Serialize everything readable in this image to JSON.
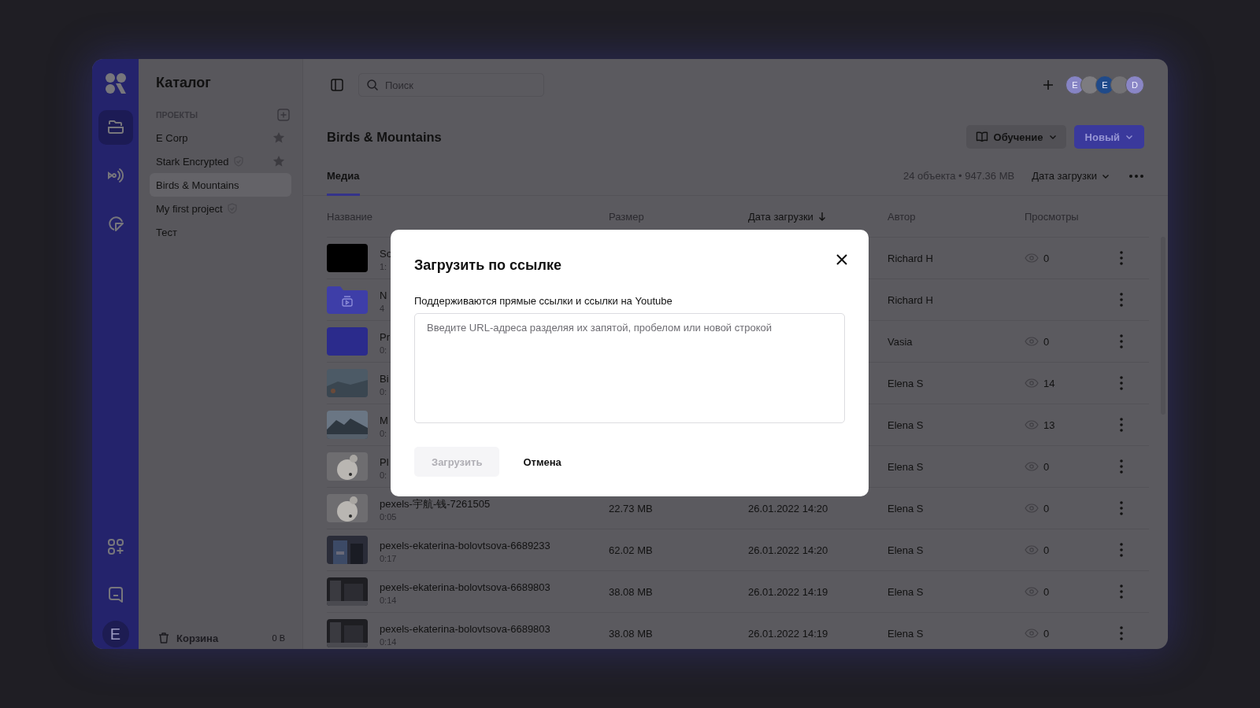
{
  "rail": {
    "items": [
      {
        "kind": "folder",
        "selected": true
      },
      {
        "kind": "broadcast",
        "selected": false
      },
      {
        "kind": "chart",
        "selected": false
      }
    ],
    "bottom": [
      {
        "kind": "apps"
      },
      {
        "kind": "chat"
      }
    ],
    "avatar": {
      "letter": "E"
    }
  },
  "sidebar": {
    "title": "Каталог",
    "section": "ПРОЕКТЫ",
    "items": [
      {
        "label": "E Corp",
        "verified": false,
        "starred": true,
        "selected": false
      },
      {
        "label": "Stark Encrypted",
        "verified": true,
        "starred": true,
        "selected": false
      },
      {
        "label": "Birds & Mountains",
        "verified": false,
        "starred": false,
        "selected": true
      },
      {
        "label": "My first project",
        "verified": true,
        "starred": false,
        "selected": false
      },
      {
        "label": "Тест",
        "verified": false,
        "starred": false,
        "selected": false
      }
    ],
    "trash": {
      "label": "Корзина",
      "size": "0 B"
    }
  },
  "topbar": {
    "search": {
      "placeholder": "Поиск"
    },
    "avatars": [
      {
        "letter": "E",
        "color": "#8684c4"
      },
      {
        "color": "#7d7c80"
      },
      {
        "letter": "E",
        "color": "#1f4a8a"
      },
      {
        "color": "#737275"
      },
      {
        "letter": "D",
        "color": "#8a86c6"
      }
    ]
  },
  "header": {
    "title": "Birds & Mountains",
    "buttons": [
      {
        "label": "Обучение",
        "kind": "secondary"
      },
      {
        "label": "Новый",
        "kind": "primary"
      }
    ]
  },
  "tabs": [
    {
      "label": "Медиа",
      "selected": true
    }
  ],
  "summary": "24 объекта • 947.36 MB",
  "sort": "Дата загрузки",
  "table": {
    "columns": [
      {
        "label": "Название",
        "sorted": false
      },
      {
        "label": "Размер",
        "sorted": false
      },
      {
        "label": "Дата загрузки",
        "sorted": true
      },
      {
        "label": "Автор",
        "sorted": false
      },
      {
        "label": "Просмотры",
        "sorted": false
      }
    ],
    "rows": [
      {
        "thumb": {
          "kind": "solid",
          "color": "#000000"
        },
        "name": "So",
        "duration": "1:",
        "author": "Richard H",
        "views": "0"
      },
      {
        "thumb": {
          "kind": "folder"
        },
        "name": "N",
        "duration": "4",
        "author": "Richard H"
      },
      {
        "thumb": {
          "kind": "solid",
          "color": "#2b2b8c"
        },
        "name": "Pr",
        "duration": "0:",
        "author": "Vasia",
        "views": "0"
      },
      {
        "name": "Bi",
        "duration": "0:",
        "author": "Elena S",
        "views": "14"
      },
      {
        "name": "M",
        "duration": "0:",
        "author": "Elena S",
        "views": "13"
      },
      {
        "name": "Pl",
        "duration": "0:",
        "author": "Elena S",
        "views": "0"
      },
      {
        "name": "pexels-宇航-钱-7261505",
        "duration": "0:05",
        "size": "22.73 MB",
        "date": "26.01.2022 14:20",
        "author": "Elena S",
        "views": "0"
      },
      {
        "name": "pexels-ekaterina-bolovtsova-6689233",
        "duration": "0:17",
        "size": "62.02 MB",
        "date": "26.01.2022 14:20",
        "author": "Elena S",
        "views": "0"
      },
      {
        "name": "pexels-ekaterina-bolovtsova-6689803",
        "duration": "0:14",
        "size": "38.08 MB",
        "date": "26.01.2022 14:19",
        "author": "Elena S",
        "views": "0"
      },
      {
        "name": "pexels-ekaterina-bolovtsova-6689803",
        "duration": "0:14",
        "size": "38.08 MB",
        "date": "26.01.2022 14:19",
        "author": "Elena S",
        "views": "0"
      }
    ]
  },
  "dialog": {
    "title": "Загрузить по ссылке",
    "label": "Поддерживаются прямые ссылки и ссылки на Youtube",
    "placeholder": "Введите URL-адреса разделяя их запятой, пробелом или новой строкой",
    "buttons": [
      {
        "label": "Загрузить",
        "kind": "primary",
        "disabled": true
      },
      {
        "label": "Отмена",
        "kind": "text",
        "disabled": false
      }
    ]
  }
}
